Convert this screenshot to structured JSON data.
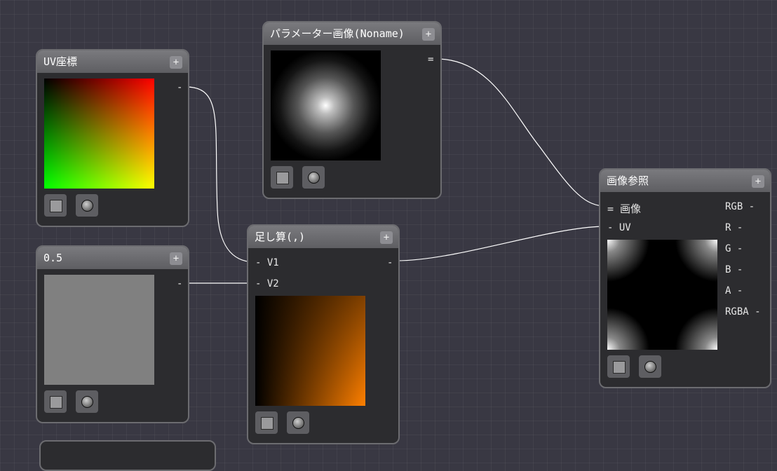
{
  "nodes": {
    "uv": {
      "title": "UV座標",
      "add": "+",
      "out": "-"
    },
    "param_image": {
      "title": "パラメーター画像(Noname)",
      "add": "+",
      "out": "="
    },
    "half": {
      "title": "0.5",
      "add": "+",
      "out": "-"
    },
    "add_node": {
      "title": "足し算(,)",
      "add": "+",
      "in1": "- V1",
      "in2": "- V2",
      "out": "-"
    },
    "image_ref": {
      "title": "画像参照",
      "add": "+",
      "in_image": "= 画像",
      "in_uv": "- UV",
      "outputs": [
        "RGB -",
        "R -",
        "G -",
        "B -",
        "A -",
        "RGBA -"
      ]
    }
  },
  "colors": {
    "wire": "#ffffff",
    "background": "#393843",
    "node_body": "#2c2c2f",
    "node_header": "#6e6e72",
    "value_preview": "#808080"
  },
  "icons": {
    "stop": "square-icon",
    "sphere": "sphere-icon",
    "add": "plus-icon"
  }
}
